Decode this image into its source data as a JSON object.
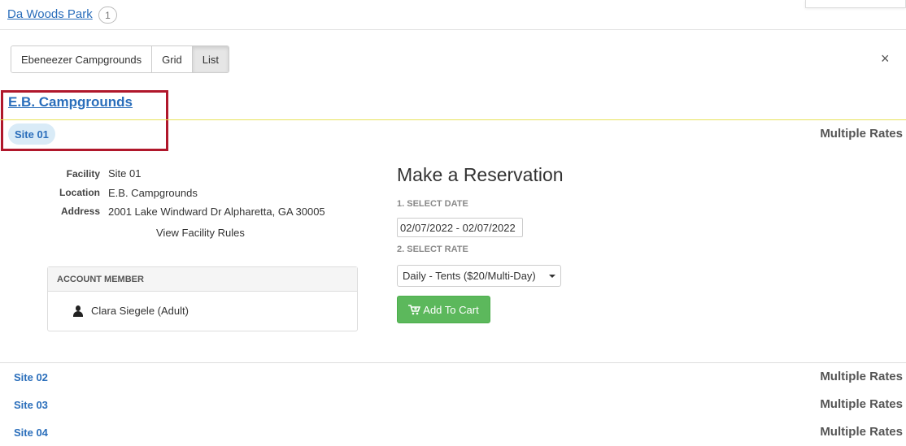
{
  "header": {
    "park_name": "Da Woods Park",
    "count": "1"
  },
  "view_toggle": {
    "items": [
      "Ebeneezer Campgrounds",
      "Grid",
      "List"
    ],
    "active": "List"
  },
  "close_label": "×",
  "campground": {
    "title": "E.B. Campgrounds"
  },
  "sites": [
    {
      "name": "Site 01",
      "rate": "Multiple Rates"
    },
    {
      "name": "Site 02",
      "rate": "Multiple Rates"
    },
    {
      "name": "Site 03",
      "rate": "Multiple Rates"
    },
    {
      "name": "Site 04",
      "rate": "Multiple Rates"
    }
  ],
  "details": {
    "facility_label": "Facility",
    "facility_value": "Site 01",
    "location_label": "Location",
    "location_value": "E.B. Campgrounds",
    "address_label": "Address",
    "address_value": "2001 Lake Windward Dr Alpharetta, GA 30005",
    "rules_link": "View Facility Rules"
  },
  "member_panel": {
    "heading": "ACCOUNT MEMBER",
    "member_name": "Clara Siegele (Adult)"
  },
  "reservation": {
    "title": "Make a Reservation",
    "step1_label": "1. SELECT DATE",
    "date_value": "02/07/2022 - 02/07/2022",
    "step2_label": "2. SELECT RATE",
    "rate_selected": "Daily - Tents ($20/Multi-Day)",
    "add_to_cart_label": "Add To Cart"
  },
  "colors": {
    "link": "#2a6ebb",
    "highlight": "#b0172b",
    "button_green": "#5cb85c"
  }
}
